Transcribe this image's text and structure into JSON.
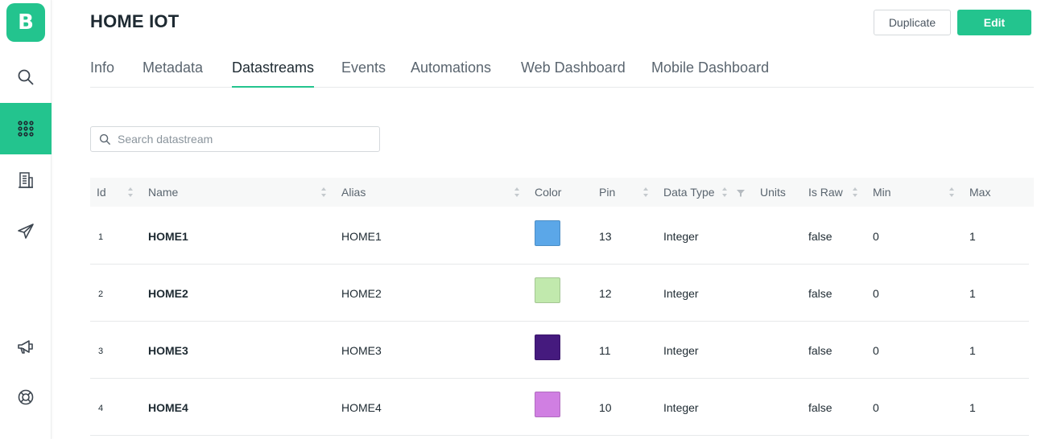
{
  "sidebar": {
    "logo_letter": "B",
    "items": [
      {
        "name": "search-icon"
      },
      {
        "name": "grid-icon",
        "active": true
      },
      {
        "name": "building-icon"
      },
      {
        "name": "send-icon"
      },
      {
        "name": "megaphone-icon"
      },
      {
        "name": "lifebuoy-icon"
      }
    ],
    "accent_color": "#23c48e"
  },
  "header": {
    "title": "HOME IOT",
    "duplicate_label": "Duplicate",
    "edit_label": "Edit"
  },
  "tabs": [
    {
      "label": "Info"
    },
    {
      "label": "Metadata"
    },
    {
      "label": "Datastreams",
      "active": true
    },
    {
      "label": "Events"
    },
    {
      "label": "Automations"
    },
    {
      "label": "Web Dashboard"
    },
    {
      "label": "Mobile Dashboard"
    }
  ],
  "search": {
    "placeholder": "Search datastream",
    "value": ""
  },
  "table": {
    "columns": [
      "Id",
      "Name",
      "Alias",
      "Color",
      "Pin",
      "Data Type",
      "Units",
      "Is Raw",
      "Min",
      "Max"
    ],
    "rows": [
      {
        "id": "1",
        "name": "HOME1",
        "alias": "HOME1",
        "color": "#5ba7e8",
        "pin": "13",
        "data_type": "Integer",
        "units": "",
        "is_raw": "false",
        "min": "0",
        "max": "1"
      },
      {
        "id": "2",
        "name": "HOME2",
        "alias": "HOME2",
        "color": "#c1e9ad",
        "pin": "12",
        "data_type": "Integer",
        "units": "",
        "is_raw": "false",
        "min": "0",
        "max": "1"
      },
      {
        "id": "3",
        "name": "HOME3",
        "alias": "HOME3",
        "color": "#451a7e",
        "pin": "11",
        "data_type": "Integer",
        "units": "",
        "is_raw": "false",
        "min": "0",
        "max": "1"
      },
      {
        "id": "4",
        "name": "HOME4",
        "alias": "HOME4",
        "color": "#d07fe2",
        "pin": "10",
        "data_type": "Integer",
        "units": "",
        "is_raw": "false",
        "min": "0",
        "max": "1"
      }
    ]
  }
}
